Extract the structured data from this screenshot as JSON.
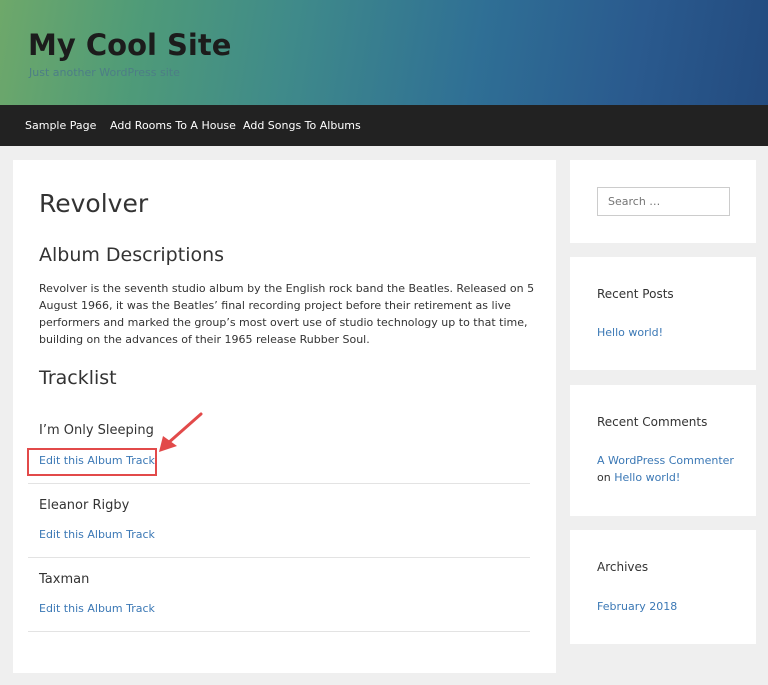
{
  "site": {
    "title": "My Cool Site",
    "tagline": "Just another WordPress site"
  },
  "nav": {
    "items": [
      {
        "label": "Sample Page"
      },
      {
        "label": "Add Rooms To A House"
      },
      {
        "label": "Add Songs To Albums"
      }
    ]
  },
  "main": {
    "title": "Revolver",
    "description_heading": "Album Descriptions",
    "description": "Revolver is the seventh studio album by the English rock band the Beatles. Released on 5 August 1966, it was the Beatles’ final recording project before their retirement as live performers and marked the group’s most overt use of studio technology up to that time, building on the advances of their 1965 release Rubber Soul.",
    "tracklist_heading": "Tracklist",
    "tracks": [
      {
        "title": "I’m Only Sleeping",
        "edit_label": "Edit this Album Track"
      },
      {
        "title": "Eleanor Rigby",
        "edit_label": "Edit this Album Track"
      },
      {
        "title": "Taxman",
        "edit_label": "Edit this Album Track"
      }
    ]
  },
  "sidebar": {
    "search": {
      "placeholder": "Search …"
    },
    "recent_posts": {
      "title": "Recent Posts",
      "items": [
        {
          "label": "Hello world!"
        }
      ]
    },
    "recent_comments": {
      "title": "Recent Comments",
      "items": [
        {
          "author": "A WordPress Commenter",
          "on": "on",
          "post": "Hello world!"
        }
      ]
    },
    "archives": {
      "title": "Archives",
      "items": [
        {
          "label": "February 2018"
        }
      ]
    }
  },
  "colors": {
    "link": "#3b78b5",
    "nav_bg": "#222222",
    "annotation": "#e24a4a"
  }
}
